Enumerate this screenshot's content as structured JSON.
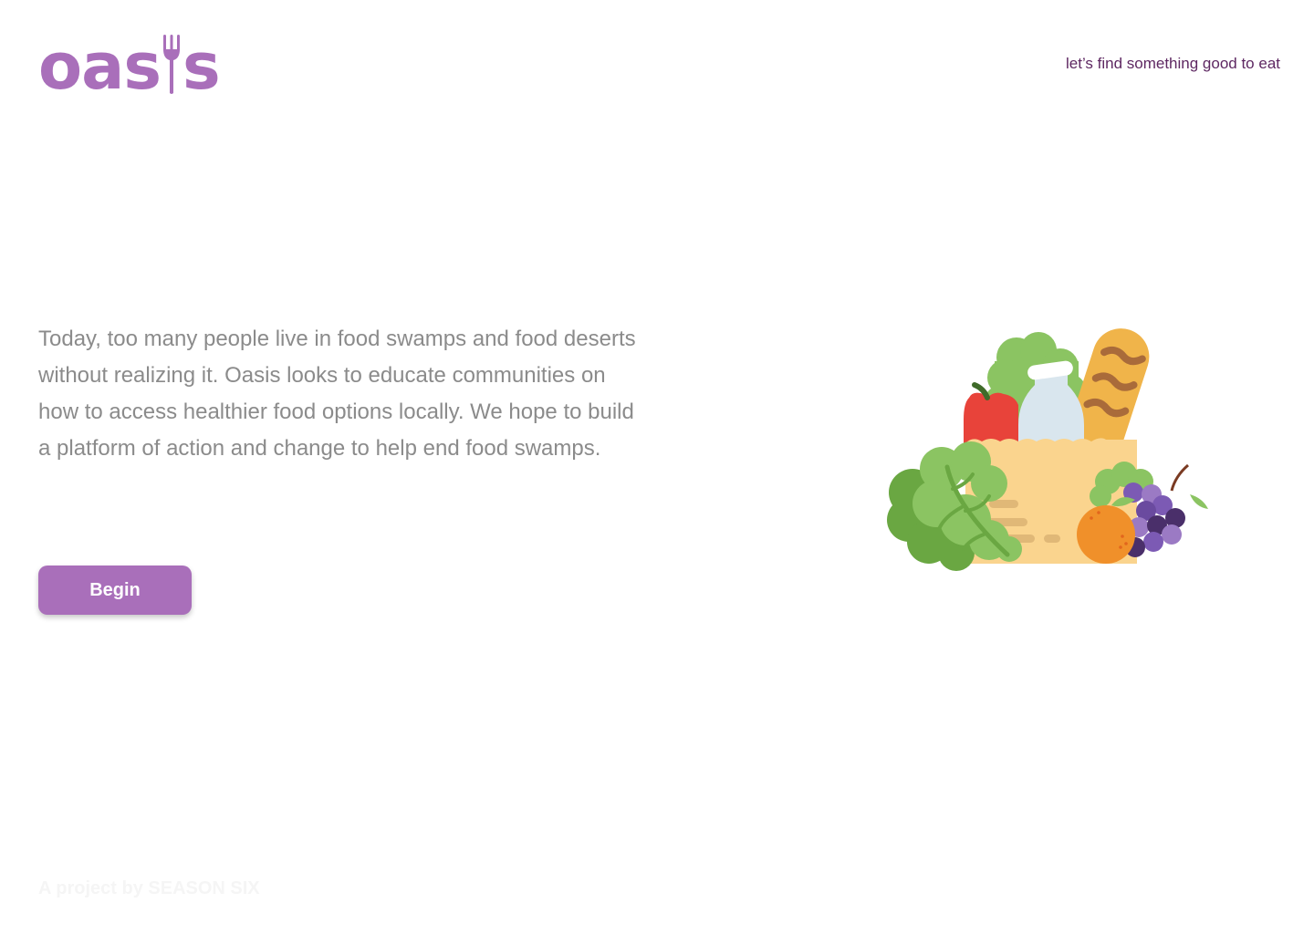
{
  "header": {
    "logo_text_before": "oas",
    "logo_text_after": "s",
    "tagline": "let’s find something good to eat"
  },
  "main": {
    "intro": "Today, too many people live in food swamps and food deserts without realizing it. Oasis looks to educate communities on how to access healthier food options locally. We hope to build a platform of action and change to help end food swamps.",
    "begin_label": "Begin"
  },
  "footer": {
    "credit": "A project by SEASON SIX"
  },
  "icons": {
    "logo_fork": "fork-icon",
    "illustration": "grocery-bag-illustration"
  },
  "colors": {
    "brand": "#a96fba",
    "tagline": "#5e2862",
    "body_text": "#8b8b8b"
  }
}
